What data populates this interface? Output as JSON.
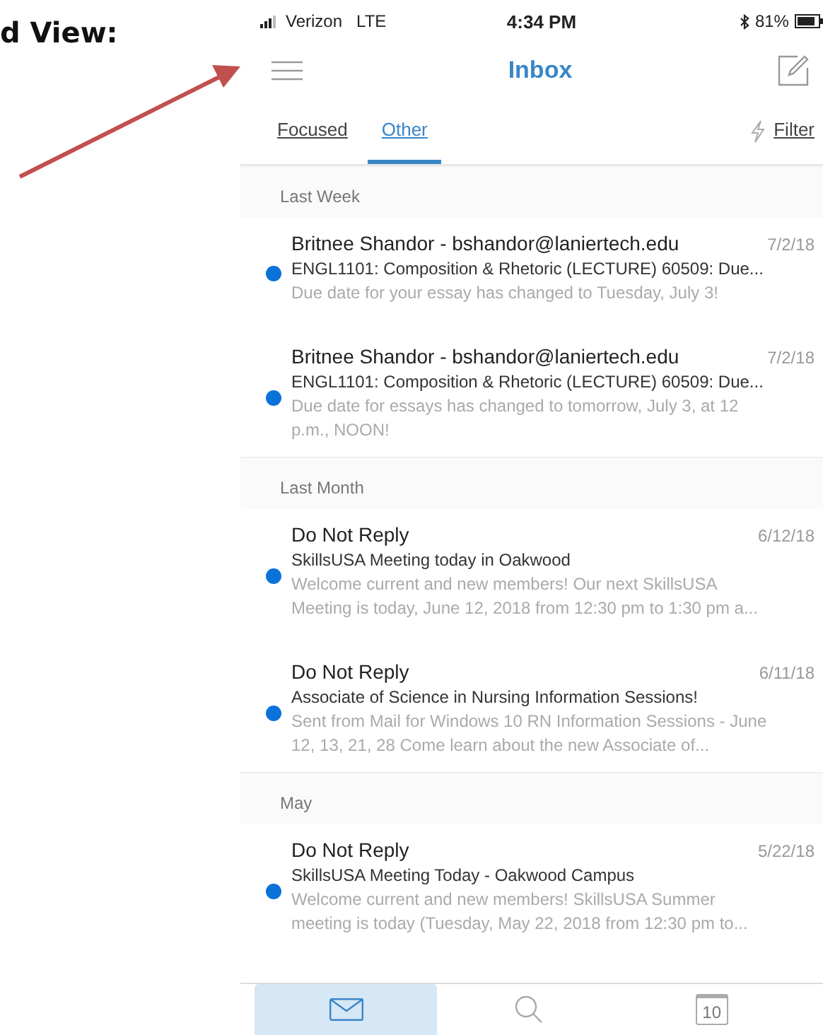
{
  "heading": "d View:",
  "status_bar": {
    "carrier": "Verizon",
    "network": "LTE",
    "time": "4:34 PM",
    "battery": "81%"
  },
  "header": {
    "title": "Inbox"
  },
  "tabs": [
    {
      "label": "Focused",
      "selected": false
    },
    {
      "label": "Other",
      "selected": true
    }
  ],
  "filter": {
    "label": "Filter"
  },
  "sections": [
    {
      "title": "Last Week",
      "messages": [
        {
          "sender": "Britnee Shandor - bshandor@laniertech.edu",
          "date": "7/2/18",
          "subject": "ENGL1101: Composition & Rhetoric (LECTURE) 60509: Due...",
          "preview": "Due date for your essay has changed to Tuesday, July 3!",
          "unread": true
        },
        {
          "sender": "Britnee Shandor - bshandor@laniertech.edu",
          "date": "7/2/18",
          "subject": "ENGL1101: Composition & Rhetoric (LECTURE) 60509: Due...",
          "preview": "Due date for essays has changed to tomorrow, July 3, at 12 p.m., NOON!",
          "unread": true
        }
      ]
    },
    {
      "title": "Last Month",
      "messages": [
        {
          "sender": "Do Not Reply",
          "date": "6/12/18",
          "subject": "SkillsUSA Meeting today in Oakwood",
          "preview": "Welcome current and new members! Our next SkillsUSA Meeting is today, June 12, 2018 from 12:30 pm to 1:30 pm a...",
          "unread": true
        },
        {
          "sender": "Do Not Reply",
          "date": "6/11/18",
          "subject": "Associate of Science in Nursing Information Sessions!",
          "preview": "Sent from Mail for Windows 10 RN Information Sessions - June 12, 13, 21, 28 Come learn about the new Associate of...",
          "unread": true
        }
      ]
    },
    {
      "title": "May",
      "messages": [
        {
          "sender": "Do Not Reply",
          "date": "5/22/18",
          "subject": "SkillsUSA Meeting Today - Oakwood Campus",
          "preview": "Welcome current and new members! SkillsUSA Summer meeting is today (Tuesday, May 22, 2018 from 12:30 pm to...",
          "unread": true
        }
      ]
    }
  ],
  "bottom_tabs": [
    {
      "kind": "mail",
      "selected": true
    },
    {
      "kind": "search",
      "selected": false
    },
    {
      "kind": "calendar",
      "selected": false,
      "label": "10"
    }
  ]
}
